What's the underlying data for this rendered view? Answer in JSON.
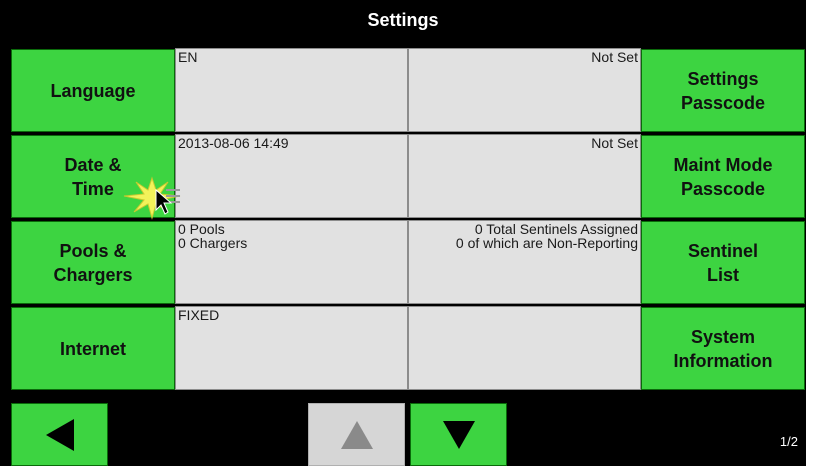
{
  "title": "Settings",
  "left_buttons": [
    "Language",
    "Date &\nTime",
    "Pools &\nChargers",
    "Internet"
  ],
  "right_buttons": [
    "Settings\nPasscode",
    "Maint Mode\nPasscode",
    "Sentinel\nList",
    "System\nInformation"
  ],
  "rows": [
    {
      "left_value": "EN",
      "right_value": "Not Set"
    },
    {
      "left_value": "2013-08-06  14:49",
      "right_value": "Not Set"
    },
    {
      "left_value": "0 Pools\n0 Chargers",
      "right_value": "0 Total Sentinels Assigned\n0 of which are Non-Reporting"
    },
    {
      "left_value": "FIXED",
      "right_value": ""
    }
  ],
  "page_indicator": "1/2",
  "icons": {
    "back": "left-arrow-icon",
    "up": "up-arrow-icon",
    "down": "down-arrow-icon",
    "cursor": "pointer-cursor-icon"
  },
  "colors": {
    "button_green": "#3dd441",
    "cell_gray": "#e1e1e1",
    "background": "#000000",
    "up_disabled": "#d6d6d6"
  }
}
